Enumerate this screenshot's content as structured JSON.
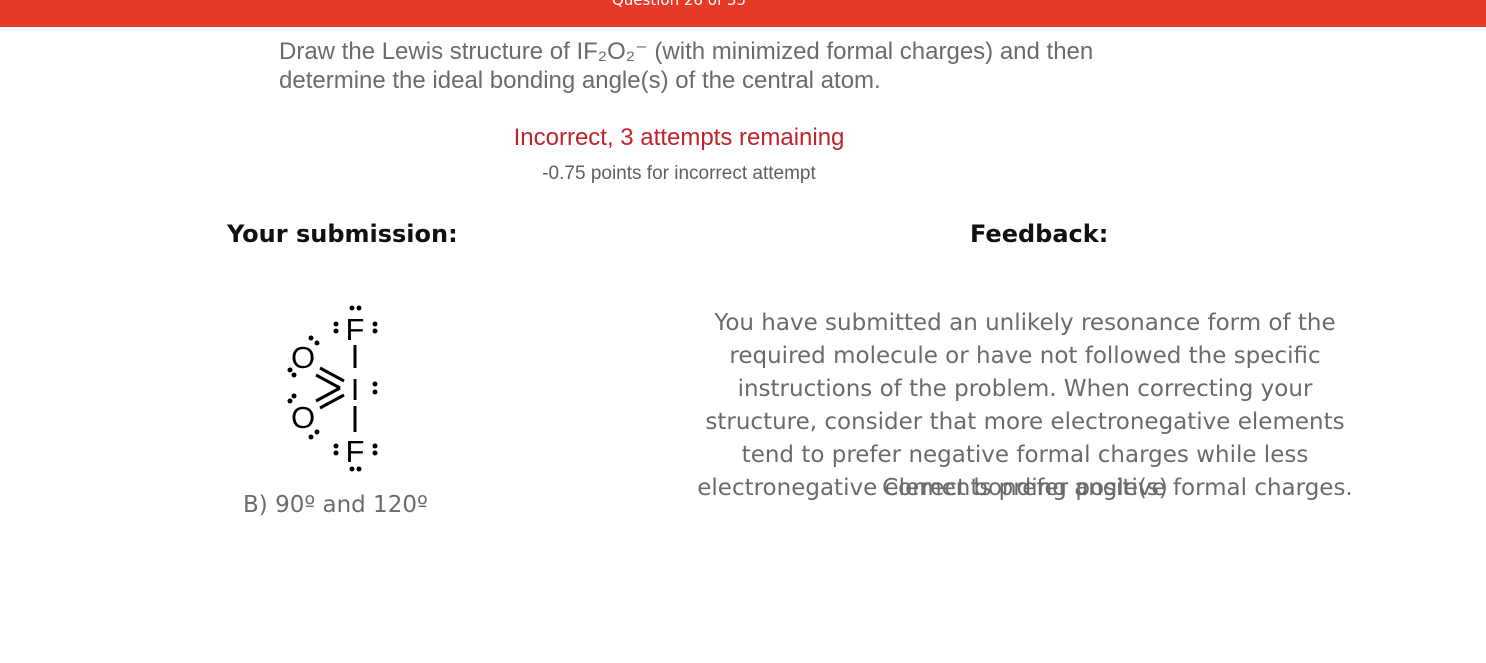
{
  "header": {
    "title": "Question 26 of 35",
    "bar_color": "#e53a27"
  },
  "question": {
    "text": "Draw the Lewis structure of IF₂O₂⁻ (with minimized formal charges) and then determine the ideal bonding angle(s) of the central atom."
  },
  "result": {
    "status": "Incorrect, 3 attempts remaining",
    "status_color": "#c0232c",
    "penalty": "-0.75 points for incorrect attempt"
  },
  "submission": {
    "heading": "Your submission:",
    "structure_atoms": {
      "top": "F",
      "center": "I",
      "bottom": "F",
      "upper_left": "O",
      "lower_left": "O"
    },
    "answer": "B) 90º and 120º"
  },
  "feedback": {
    "heading": "Feedback:",
    "text": "You have submitted an unlikely resonance form of the required molecule or have not followed the specific instructions of the problem. When correcting your structure, consider that more electronegative elements tend to prefer negative formal charges while less electronegative elements prefer positive formal charges.",
    "overlap_text": "Correct bonding angle(s)"
  }
}
